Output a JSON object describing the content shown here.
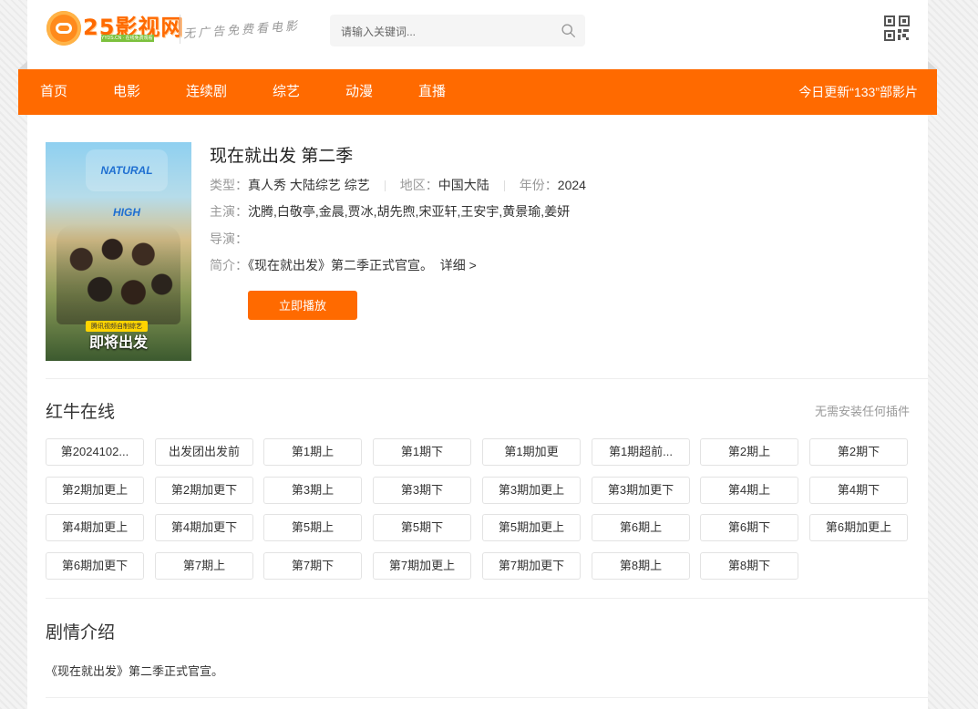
{
  "header": {
    "logo_name": "25影视网",
    "logo_sub": "YYDS.CN · 在线免费观看",
    "slogan": "无广告免费看电影",
    "search_placeholder": "请输入关键词..."
  },
  "nav": {
    "items": [
      "首页",
      "电影",
      "连续剧",
      "综艺",
      "动漫",
      "直播"
    ],
    "update_text": "今日更新“133”部影片"
  },
  "poster": {
    "logo_text": "NATURAL HIGH",
    "tag": "腾讯视频自制综艺",
    "caption": "即将出发"
  },
  "detail": {
    "title": "现在就出发 第二季",
    "type_label": "类型：",
    "type_value": "真人秀 大陆综艺 综艺",
    "region_label": "地区：",
    "region_value": "中国大陆",
    "year_label": "年份：",
    "year_value": "2024",
    "cast_label": "主演：",
    "cast_value": "沈腾,白敬亭,金晨,贾冰,胡先煦,宋亚轩,王安宇,黄景瑜,姜妍",
    "director_label": "导演：",
    "director_value": "",
    "intro_label": "简介：",
    "intro_value": "《现在就出发》第二季正式官宣。",
    "more_link": "详细 >",
    "play_button": "立即播放"
  },
  "playlist": {
    "title": "红牛在线",
    "note": "无需安装任何插件",
    "episodes": [
      "第2024102...",
      "出发团出发前",
      "第1期上",
      "第1期下",
      "第1期加更",
      "第1期超前...",
      "第2期上",
      "第2期下",
      "第2期加更上",
      "第2期加更下",
      "第3期上",
      "第3期下",
      "第3期加更上",
      "第3期加更下",
      "第4期上",
      "第4期下",
      "第4期加更上",
      "第4期加更下",
      "第5期上",
      "第5期下",
      "第5期加更上",
      "第6期上",
      "第6期下",
      "第6期加更上",
      "第6期加更下",
      "第7期上",
      "第7期下",
      "第7期加更上",
      "第7期加更下",
      "第8期上",
      "第8期下"
    ]
  },
  "synopsis": {
    "title": "剧情介绍",
    "text": "《现在就出发》第二季正式官宣。"
  },
  "colors": {
    "accent": "#ff6a00"
  }
}
